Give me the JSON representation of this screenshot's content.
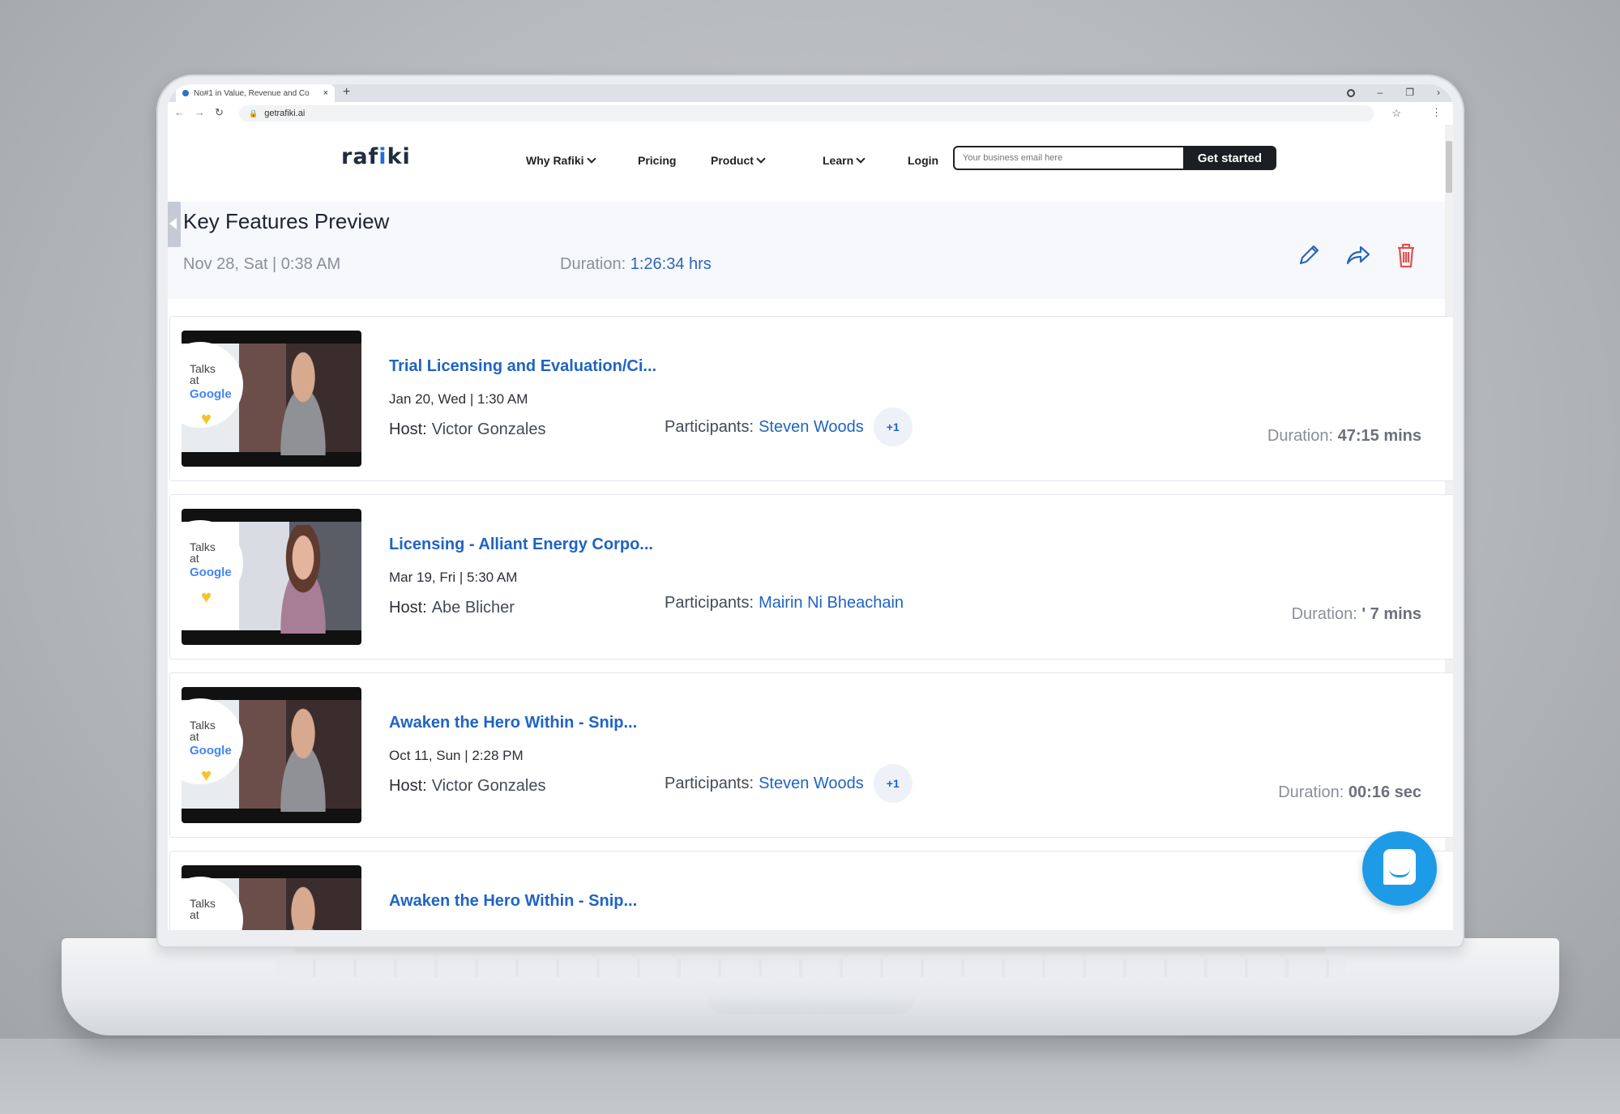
{
  "browser": {
    "tab_title": "No#1 in Value, Revenue and Co",
    "tab_close": "×",
    "new_tab": "+",
    "url": "getrafiki.ai"
  },
  "site": {
    "logo_left": "raf",
    "logo_mid": "i",
    "logo_right": "ki",
    "nav": [
      {
        "label": "Why Rafiki",
        "dropdown": true
      },
      {
        "label": "Pricing",
        "dropdown": false
      },
      {
        "label": "Product",
        "dropdown": true
      },
      {
        "label": "Learn",
        "dropdown": true
      },
      {
        "label": "Login",
        "dropdown": false
      }
    ],
    "email_placeholder": "Your business email here",
    "cta_label": "Get started"
  },
  "meeting": {
    "title": "Key Features Preview",
    "date": "Nov 28, Sat | 0:38 AM",
    "duration_label": "Duration:",
    "duration_value": "1:26:34 hrs",
    "actions": [
      "pencil-icon",
      "share-icon",
      "trash-icon"
    ]
  },
  "recordings": [
    {
      "title": "Trial Licensing and Evaluation/Ci...",
      "date": "Jan 20, Wed | 1:30 AM",
      "host_label": "Host:",
      "host": "Victor Gonzales",
      "participants_label": "Participants:",
      "participant": "Steven Woods",
      "extra": "+1",
      "duration_label": "Duration:",
      "duration": "47:15 mins",
      "thumb_text_1": "Talks",
      "thumb_text_2": "at",
      "thumb_brand": "Google"
    },
    {
      "title": "Licensing - Alliant Energy Corpo...",
      "date": "Mar 19, Fri | 5:30 AM",
      "host_label": "Host:",
      "host": "Abe Blicher",
      "participants_label": "Participants:",
      "participant": "Mairin Ni Bheachain",
      "extra": "",
      "duration_label": "Duration:",
      "duration": "' 7 mins",
      "thumb_text_1": "Talks",
      "thumb_text_2": "at",
      "thumb_brand": "Google"
    },
    {
      "title": "Awaken the Hero Within - Snip...",
      "date": "Oct 11, Sun | 2:28 PM",
      "host_label": "Host:",
      "host": "Victor Gonzales",
      "participants_label": "Participants:",
      "participant": "Steven Woods",
      "extra": "+1",
      "duration_label": "Duration:",
      "duration": "00:16 sec",
      "thumb_text_1": "Talks",
      "thumb_text_2": "at",
      "thumb_brand": "Google"
    },
    {
      "title": "Awaken the Hero Within - Snip...",
      "thumb_text_1": "Talks",
      "thumb_text_2": "at"
    }
  ],
  "colors": {
    "accent_blue": "#1f64c4",
    "chat_blue": "#1e9be6",
    "delete_red": "#e0514d"
  }
}
